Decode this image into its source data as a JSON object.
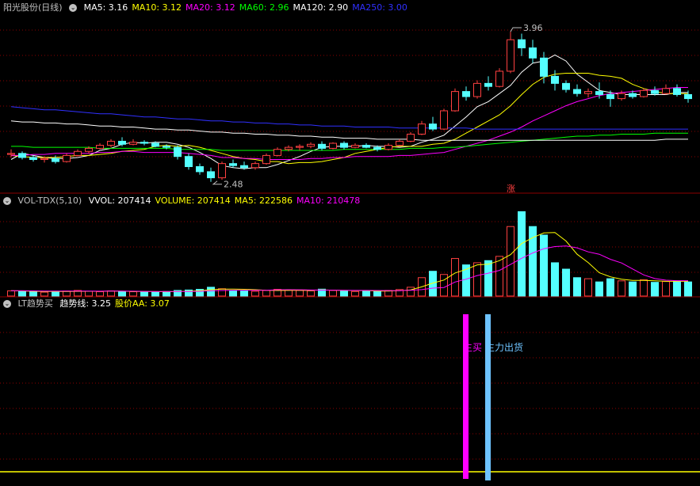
{
  "price_panel": {
    "stock_name": "阳光股份(日线)",
    "ma_labels": [
      {
        "text": "MA5: 3.16",
        "color": "#ffffff"
      },
      {
        "text": "MA10: 3.12",
        "color": "#ffff00"
      },
      {
        "text": "MA20: 3.12",
        "color": "#ff00ff"
      },
      {
        "text": "MA60: 2.96",
        "color": "#00ff00"
      },
      {
        "text": "MA120: 2.90",
        "color": "#ffffff"
      },
      {
        "text": "MA250: 3.00",
        "color": "#3030ff"
      }
    ],
    "high_label": "3.96",
    "low_label": "2.48",
    "limit_up_marker": "涨"
  },
  "volume_panel": {
    "title": "VOL-TDX(5,10)",
    "labels": [
      {
        "text": "VVOL: 207414",
        "color": "#ffffff"
      },
      {
        "text": "VOLUME: 207414",
        "color": "#ffff00"
      },
      {
        "text": "MA5: 222586",
        "color": "#ffff00"
      },
      {
        "text": "MA10: 210478",
        "color": "#ff00ff"
      }
    ]
  },
  "indicator_panel": {
    "title": "LT趋势买",
    "labels": [
      {
        "text": "趋势线: 3.25",
        "color": "#ffffff"
      },
      {
        "text": "股价AA: 3.07",
        "color": "#ffff00"
      }
    ],
    "signal_buy": "主买",
    "signal_sell": "主力出货"
  },
  "colors": {
    "up": "#ff4040",
    "down": "#54ffff",
    "grid": "#8b0000",
    "ma5": "#ffffff",
    "ma10": "#ffff00",
    "ma20": "#ff00ff",
    "ma60": "#00ff00",
    "ma120": "#ffffff",
    "ma250": "#3030ff",
    "buy_bar": "#ff00ff",
    "sell_bar": "#6ec3ff"
  },
  "chart_data": [
    {
      "type": "candlestick",
      "ohlc": [
        [
          2.75,
          2.8,
          2.72,
          2.76
        ],
        [
          2.76,
          2.78,
          2.7,
          2.72
        ],
        [
          2.72,
          2.74,
          2.68,
          2.7
        ],
        [
          2.7,
          2.73,
          2.67,
          2.71
        ],
        [
          2.71,
          2.74,
          2.66,
          2.68
        ],
        [
          2.68,
          2.76,
          2.67,
          2.74
        ],
        [
          2.74,
          2.8,
          2.73,
          2.78
        ],
        [
          2.78,
          2.83,
          2.76,
          2.81
        ],
        [
          2.81,
          2.86,
          2.8,
          2.84
        ],
        [
          2.84,
          2.9,
          2.82,
          2.88
        ],
        [
          2.88,
          2.92,
          2.83,
          2.85
        ],
        [
          2.85,
          2.9,
          2.84,
          2.87
        ],
        [
          2.87,
          2.89,
          2.84,
          2.86
        ],
        [
          2.86,
          2.88,
          2.82,
          2.83
        ],
        [
          2.83,
          2.85,
          2.8,
          2.82
        ],
        [
          2.82,
          2.84,
          2.7,
          2.73
        ],
        [
          2.73,
          2.76,
          2.6,
          2.63
        ],
        [
          2.63,
          2.66,
          2.55,
          2.58
        ],
        [
          2.58,
          2.62,
          2.48,
          2.52
        ],
        [
          2.52,
          2.68,
          2.5,
          2.66
        ],
        [
          2.66,
          2.7,
          2.62,
          2.64
        ],
        [
          2.64,
          2.68,
          2.6,
          2.62
        ],
        [
          2.62,
          2.68,
          2.6,
          2.66
        ],
        [
          2.66,
          2.76,
          2.65,
          2.74
        ],
        [
          2.74,
          2.82,
          2.73,
          2.8
        ],
        [
          2.8,
          2.84,
          2.78,
          2.82
        ],
        [
          2.82,
          2.85,
          2.79,
          2.83
        ],
        [
          2.83,
          2.87,
          2.81,
          2.85
        ],
        [
          2.85,
          2.88,
          2.79,
          2.81
        ],
        [
          2.81,
          2.87,
          2.8,
          2.86
        ],
        [
          2.86,
          2.88,
          2.8,
          2.82
        ],
        [
          2.82,
          2.86,
          2.81,
          2.84
        ],
        [
          2.84,
          2.86,
          2.81,
          2.82
        ],
        [
          2.82,
          2.84,
          2.78,
          2.8
        ],
        [
          2.8,
          2.86,
          2.79,
          2.84
        ],
        [
          2.84,
          2.9,
          2.83,
          2.88
        ],
        [
          2.88,
          2.97,
          2.87,
          2.95
        ],
        [
          2.95,
          3.08,
          2.94,
          3.05
        ],
        [
          3.05,
          3.12,
          2.98,
          3.0
        ],
        [
          3.0,
          3.2,
          2.99,
          3.18
        ],
        [
          3.18,
          3.4,
          3.17,
          3.37
        ],
        [
          3.37,
          3.42,
          3.28,
          3.32
        ],
        [
          3.32,
          3.48,
          3.3,
          3.45
        ],
        [
          3.45,
          3.52,
          3.38,
          3.42
        ],
        [
          3.42,
          3.6,
          3.41,
          3.57
        ],
        [
          3.57,
          3.96,
          3.55,
          3.88
        ],
        [
          3.88,
          3.94,
          3.72,
          3.8
        ],
        [
          3.8,
          3.88,
          3.65,
          3.7
        ],
        [
          3.7,
          3.76,
          3.45,
          3.52
        ],
        [
          3.52,
          3.58,
          3.38,
          3.45
        ],
        [
          3.45,
          3.48,
          3.36,
          3.39
        ],
        [
          3.39,
          3.44,
          3.32,
          3.35
        ],
        [
          3.35,
          3.4,
          3.31,
          3.37
        ],
        [
          3.37,
          3.46,
          3.3,
          3.34
        ],
        [
          3.34,
          3.38,
          3.22,
          3.3
        ],
        [
          3.3,
          3.38,
          3.28,
          3.35
        ],
        [
          3.35,
          3.38,
          3.3,
          3.32
        ],
        [
          3.32,
          3.4,
          3.31,
          3.38
        ],
        [
          3.38,
          3.42,
          3.33,
          3.35
        ],
        [
          3.35,
          3.44,
          3.34,
          3.4
        ],
        [
          3.4,
          3.44,
          3.32,
          3.34
        ],
        [
          3.34,
          3.38,
          3.26,
          3.3
        ]
      ],
      "ma_series": [
        {
          "name": "MA5",
          "values": [
            2.7,
            2.76,
            2.74,
            2.72,
            2.71,
            2.71,
            2.72,
            2.74,
            2.79,
            2.81,
            2.85,
            2.87,
            2.86,
            2.87,
            2.87,
            2.85,
            2.82,
            2.77,
            2.71,
            2.64,
            2.62,
            2.61,
            2.62,
            2.62,
            2.65,
            2.69,
            2.73,
            2.78,
            2.82,
            2.83,
            2.83,
            2.83,
            2.84,
            2.83,
            2.83,
            2.82,
            2.83,
            2.87,
            2.9,
            2.94,
            3.03,
            3.12,
            3.22,
            3.27,
            3.35,
            3.43,
            3.56,
            3.65,
            3.67,
            3.73,
            3.67,
            3.54,
            3.46,
            3.38,
            3.36,
            3.34,
            3.34,
            3.34,
            3.34,
            3.34,
            3.36,
            3.36
          ]
        },
        {
          "name": "MA10",
          "values": [
            2.74,
            2.73,
            2.72,
            2.72,
            2.72,
            2.73,
            2.74,
            2.74,
            2.75,
            2.76,
            2.78,
            2.79,
            2.8,
            2.83,
            2.84,
            2.83,
            2.84,
            2.82,
            2.79,
            2.76,
            2.73,
            2.71,
            2.7,
            2.68,
            2.68,
            2.66,
            2.67,
            2.67,
            2.68,
            2.7,
            2.72,
            2.76,
            2.78,
            2.8,
            2.82,
            2.83,
            2.83,
            2.83,
            2.85,
            2.86,
            2.9,
            2.96,
            3.02,
            3.08,
            3.14,
            3.23,
            3.34,
            3.44,
            3.51,
            3.54,
            3.55,
            3.55,
            3.55,
            3.53,
            3.52,
            3.5,
            3.44,
            3.4,
            3.37,
            3.35,
            3.35,
            3.35
          ]
        },
        {
          "name": "MA20",
          "values": [
            2.74,
            2.74,
            2.75,
            2.75,
            2.76,
            2.76,
            2.76,
            2.76,
            2.77,
            2.77,
            2.78,
            2.78,
            2.77,
            2.77,
            2.77,
            2.77,
            2.76,
            2.75,
            2.74,
            2.72,
            2.72,
            2.71,
            2.71,
            2.7,
            2.7,
            2.7,
            2.7,
            2.71,
            2.71,
            2.72,
            2.72,
            2.73,
            2.73,
            2.73,
            2.73,
            2.74,
            2.74,
            2.75,
            2.76,
            2.77,
            2.8,
            2.83,
            2.86,
            2.89,
            2.93,
            2.97,
            3.02,
            3.08,
            3.13,
            3.18,
            3.23,
            3.27,
            3.3,
            3.33,
            3.35,
            3.36,
            3.37,
            3.38,
            3.39,
            3.4,
            3.41,
            3.41
          ]
        },
        {
          "name": "MA60",
          "values": [
            2.83,
            2.83,
            2.82,
            2.82,
            2.82,
            2.82,
            2.82,
            2.82,
            2.81,
            2.81,
            2.81,
            2.81,
            2.81,
            2.81,
            2.81,
            2.8,
            2.8,
            2.8,
            2.8,
            2.79,
            2.79,
            2.79,
            2.79,
            2.79,
            2.79,
            2.79,
            2.79,
            2.79,
            2.79,
            2.79,
            2.8,
            2.8,
            2.8,
            2.8,
            2.8,
            2.8,
            2.81,
            2.81,
            2.81,
            2.82,
            2.82,
            2.83,
            2.84,
            2.85,
            2.86,
            2.87,
            2.88,
            2.89,
            2.9,
            2.91,
            2.92,
            2.93,
            2.93,
            2.94,
            2.94,
            2.95,
            2.95,
            2.95,
            2.96,
            2.96,
            2.96,
            2.96
          ]
        },
        {
          "name": "MA120",
          "values": [
            3.08,
            3.07,
            3.07,
            3.06,
            3.06,
            3.05,
            3.05,
            3.04,
            3.03,
            3.03,
            3.02,
            3.02,
            3.01,
            3.0,
            3.0,
            2.99,
            2.99,
            2.98,
            2.97,
            2.97,
            2.96,
            2.96,
            2.95,
            2.95,
            2.94,
            2.94,
            2.93,
            2.93,
            2.92,
            2.92,
            2.91,
            2.91,
            2.91,
            2.9,
            2.9,
            2.9,
            2.9,
            2.89,
            2.89,
            2.89,
            2.89,
            2.89,
            2.89,
            2.89,
            2.89,
            2.89,
            2.89,
            2.89,
            2.89,
            2.89,
            2.89,
            2.89,
            2.89,
            2.89,
            2.89,
            2.89,
            2.89,
            2.89,
            2.89,
            2.9,
            2.9,
            2.9
          ]
        },
        {
          "name": "MA250",
          "values": [
            3.22,
            3.21,
            3.2,
            3.19,
            3.19,
            3.18,
            3.17,
            3.16,
            3.15,
            3.15,
            3.14,
            3.13,
            3.12,
            3.12,
            3.11,
            3.1,
            3.1,
            3.09,
            3.08,
            3.08,
            3.07,
            3.07,
            3.06,
            3.06,
            3.05,
            3.05,
            3.04,
            3.04,
            3.03,
            3.03,
            3.03,
            3.02,
            3.02,
            3.02,
            3.02,
            3.01,
            3.01,
            3.01,
            3.01,
            3.01,
            3.01,
            3.01,
            3.0,
            3.0,
            3.0,
            3.0,
            3.0,
            3.0,
            3.0,
            3.0,
            3.0,
            3.0,
            3.0,
            3.0,
            3.0,
            3.0,
            3.0,
            3.0,
            3.0,
            3.0,
            3.0,
            3.0
          ]
        }
      ],
      "ylim": [
        2.4,
        4.1
      ],
      "limit_up_index": 45
    },
    {
      "type": "bar",
      "values": [
        28000,
        26000,
        24000,
        22000,
        25000,
        27000,
        30000,
        26000,
        24000,
        28000,
        25000,
        24000,
        23000,
        22000,
        25000,
        30000,
        32000,
        35000,
        45000,
        38000,
        30000,
        28000,
        26000,
        30000,
        35000,
        32000,
        30000,
        28000,
        36000,
        30000,
        27000,
        25000,
        28000,
        26000,
        30000,
        34000,
        45000,
        90000,
        120000,
        105000,
        180000,
        150000,
        160000,
        170000,
        190000,
        330000,
        400000,
        330000,
        290000,
        160000,
        130000,
        90000,
        85000,
        70000,
        85000,
        75000,
        70000,
        80000,
        68000,
        72000,
        75000,
        70000
      ],
      "ma5": [
        29000,
        27500,
        26000,
        25000,
        25000,
        24800,
        25600,
        26000,
        26200,
        27000,
        26600,
        25400,
        24800,
        24400,
        23800,
        24800,
        26400,
        28800,
        33400,
        36000,
        36000,
        35200,
        33400,
        30400,
        29800,
        30200,
        30600,
        30200,
        32200,
        31200,
        30200,
        29200,
        29200,
        27200,
        27200,
        28600,
        32600,
        47000,
        64800,
        78800,
        112000,
        129000,
        150000,
        153000,
        170000,
        198000,
        250000,
        278000,
        300000,
        302000,
        262000,
        200000,
        161000,
        113000,
        94000,
        83000,
        77000,
        77000,
        75600,
        73000,
        73000,
        73000
      ],
      "ma10": [
        29000,
        28500,
        28000,
        27200,
        26800,
        26800,
        27000,
        26800,
        26400,
        26800,
        26800,
        26400,
        25800,
        25400,
        25200,
        25200,
        25400,
        26000,
        28200,
        29600,
        30400,
        30400,
        30600,
        30800,
        33000,
        33600,
        33000,
        32000,
        31700,
        31300,
        30800,
        30000,
        30000,
        29700,
        29400,
        29000,
        30700,
        33900,
        40900,
        43800,
        69500,
        82800,
        100000,
        111000,
        124000,
        152000,
        181000,
        206000,
        226000,
        236000,
        239000,
        230000,
        211000,
        200000,
        176000,
        159000,
        131000,
        103000,
        86000,
        78000,
        76000,
        76000
      ],
      "ylim": [
        0,
        420000
      ]
    },
    {
      "type": "line",
      "trend_values": [
        3.25
      ],
      "aa_values": [
        3.07
      ],
      "buy_signal_index": 41,
      "sell_signal_index": 43
    }
  ]
}
